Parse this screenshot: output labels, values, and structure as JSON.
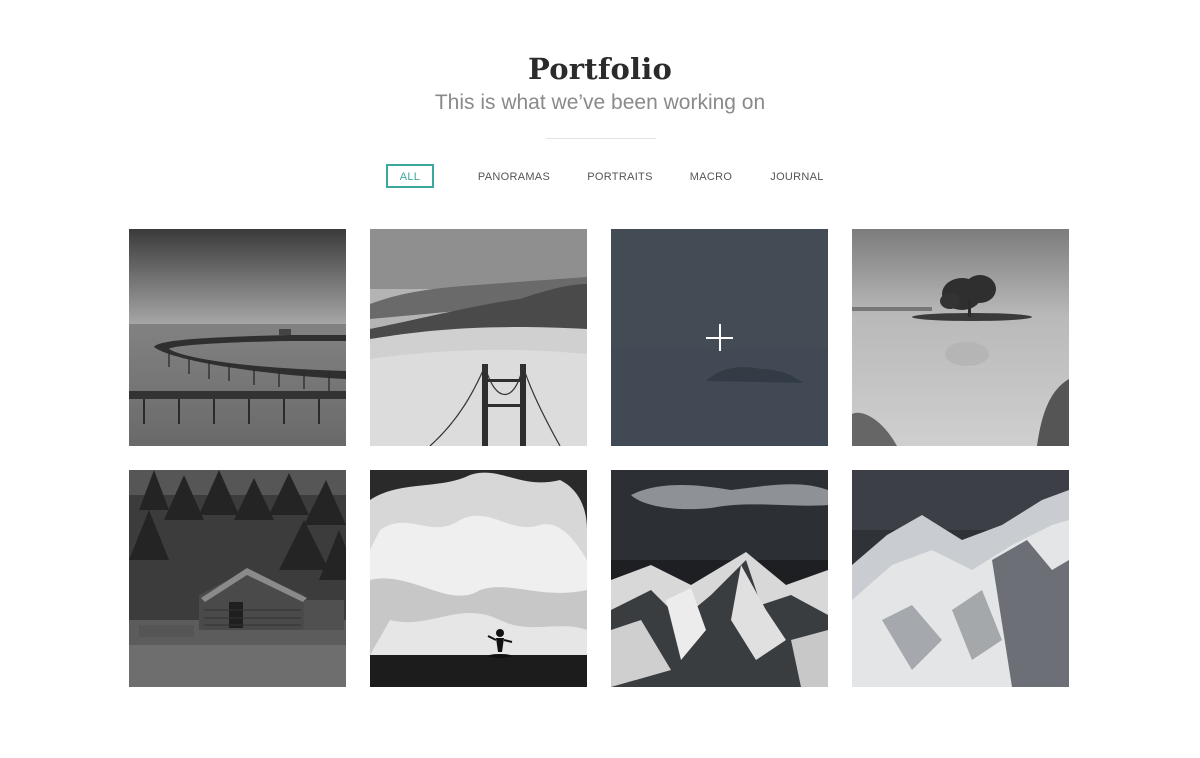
{
  "header": {
    "title": "Portfolio",
    "subtitle": "This is what we’ve been working on"
  },
  "filters": [
    {
      "label": "ALL",
      "active": true
    },
    {
      "label": "PANORAMAS",
      "active": false
    },
    {
      "label": "PORTRAITS",
      "active": false
    },
    {
      "label": "MACRO",
      "active": false
    },
    {
      "label": "JOURNAL",
      "active": false
    }
  ],
  "colors": {
    "accent": "#3aa89a",
    "overlay": "#343e48",
    "title": "#2b2b2b",
    "subtitle": "#8a8a8a"
  },
  "gallery": {
    "items": [
      {
        "subject": "pier",
        "hovered": false
      },
      {
        "subject": "golden-gate-bridge-fog",
        "hovered": false
      },
      {
        "subject": "island-lake",
        "hovered": true,
        "overlay_icon": "plus-icon"
      },
      {
        "subject": "tree-island",
        "hovered": false
      },
      {
        "subject": "log-cabin-forest",
        "hovered": false
      },
      {
        "subject": "surfer-wave",
        "hovered": false
      },
      {
        "subject": "snowy-peaks-clouds",
        "hovered": false
      },
      {
        "subject": "snowy-mountain-ridge",
        "hovered": false
      }
    ]
  }
}
